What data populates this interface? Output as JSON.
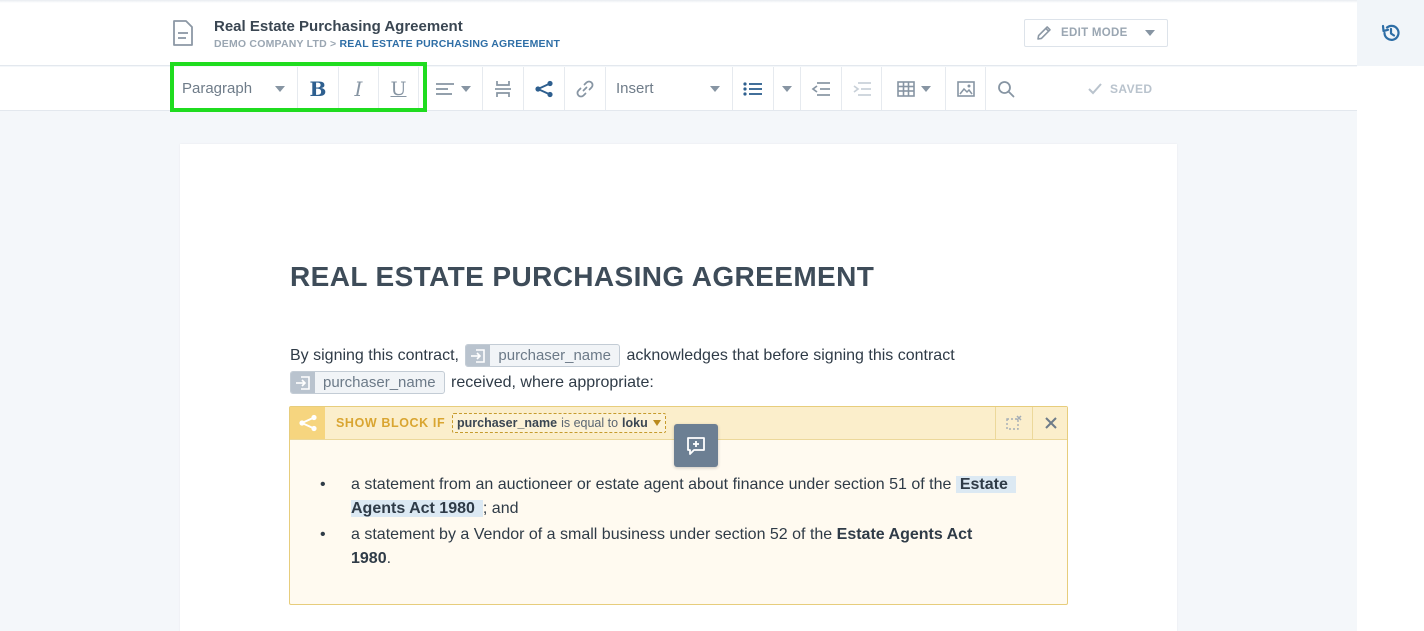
{
  "header": {
    "title": "Real Estate Purchasing Agreement",
    "breadcrumb": {
      "company": "DEMO COMPANY LTD",
      "separator": " > ",
      "current": "REAL ESTATE PURCHASING AGREEMENT"
    },
    "edit_mode_label": "EDIT MODE"
  },
  "toolbar": {
    "paragraph_select": "Paragraph",
    "bold": "B",
    "italic": "I",
    "underline": "U",
    "insert_select": "Insert",
    "saved_label": "SAVED"
  },
  "document": {
    "heading": "REAL ESTATE PURCHASING AGREEMENT",
    "para_part1": "By signing this contract,",
    "para_var1": "purchaser_name",
    "para_part2": "acknowledges that before signing this contract",
    "para_var2": "purchaser_name",
    "para_part3": "received, where appropriate:",
    "condition": {
      "label": "SHOW BLOCK IF",
      "variable": "purchaser_name",
      "operator": "is equal to",
      "value": "loku"
    },
    "list": [
      {
        "text": "a statement from an auctioneer or estate agent about finance under section 51 of the",
        "act_line1": "Estate",
        "act_line2": "Agents Act 1980",
        "after": "; and"
      },
      {
        "text": "a statement by a Vendor of a small business under section 52 of the",
        "act_line1": "Estate Agents Act",
        "act_line2": "1980",
        "after": "."
      }
    ]
  },
  "colors": {
    "accent_blue": "#2e6ea6",
    "highlight_green": "#1fdc1f",
    "condition_yellow": "#f6d57f"
  }
}
